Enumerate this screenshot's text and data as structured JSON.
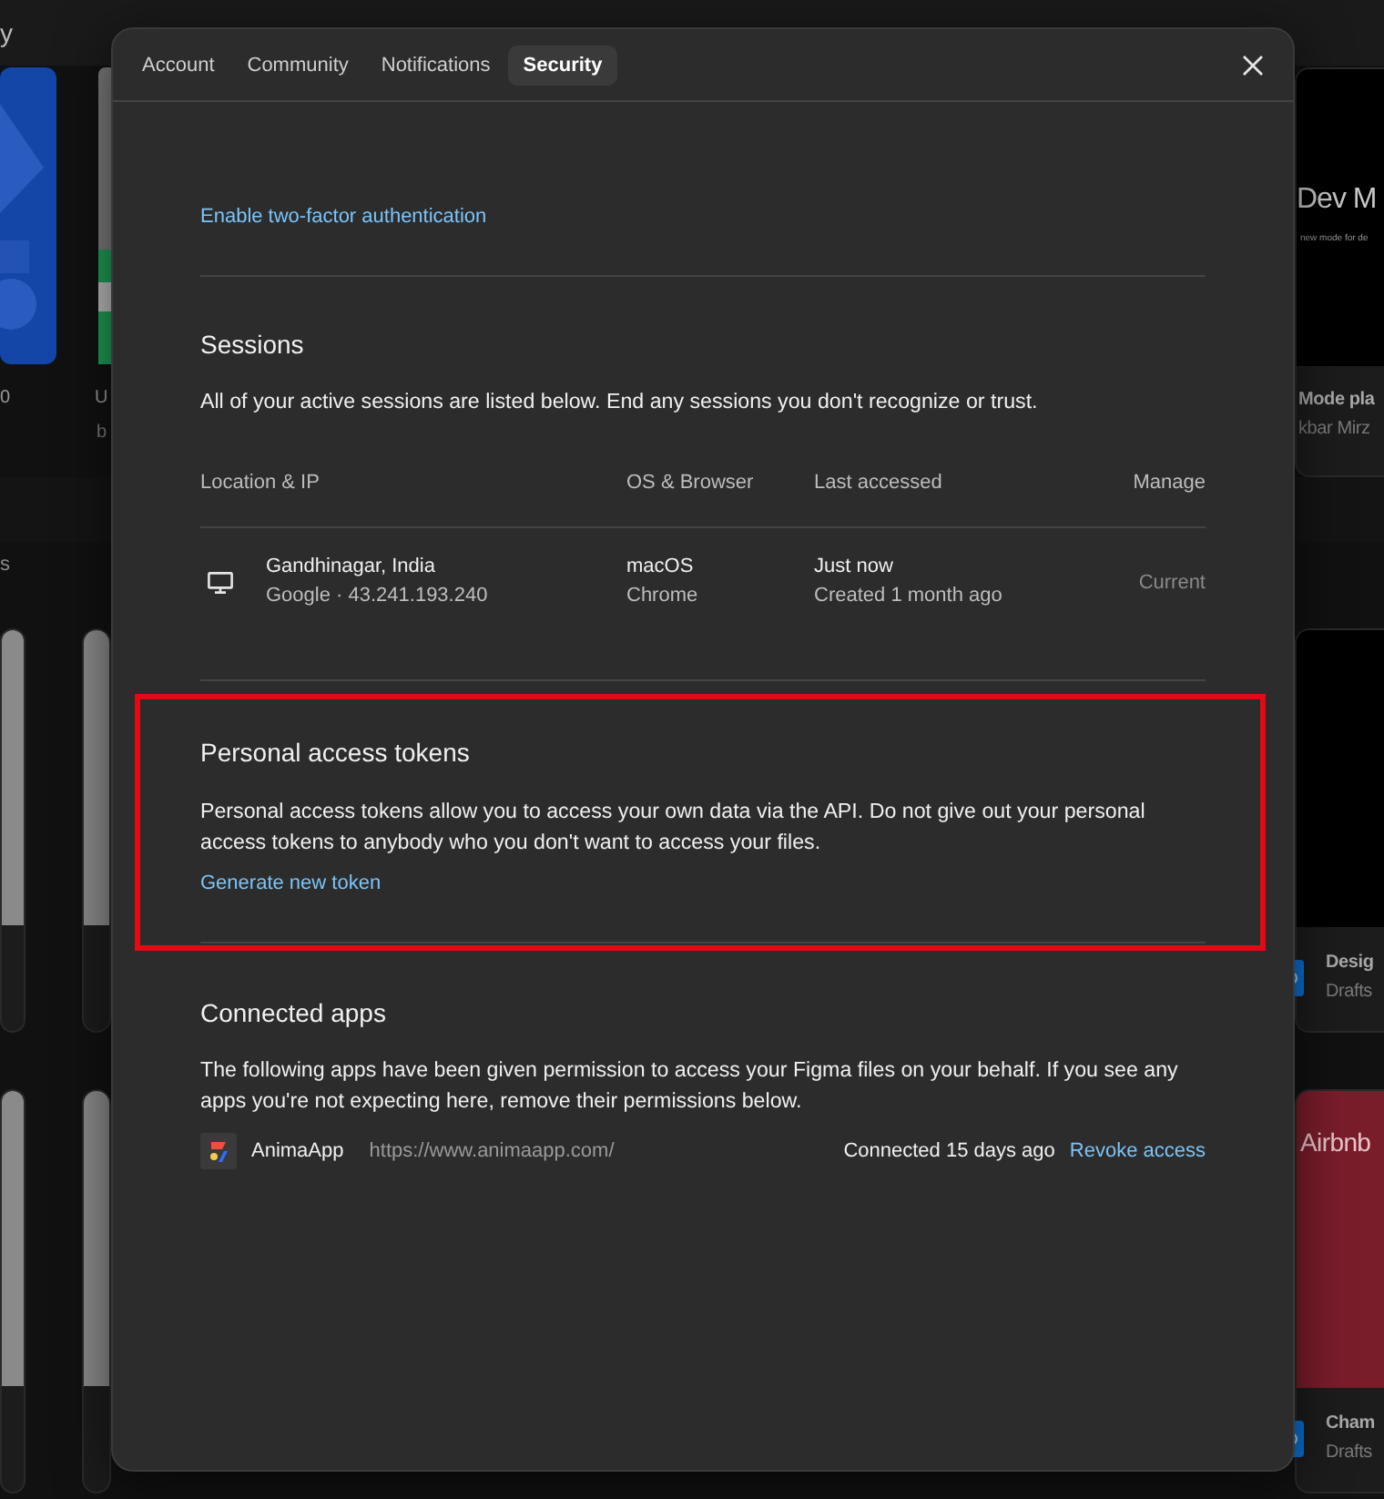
{
  "backdrop": {
    "heading_fragment": "y",
    "section_fragment": "s",
    "left_cards": [
      {
        "title": "0"
      },
      {
        "title": "U",
        "subtitle": "b"
      }
    ],
    "right_cards": [
      {
        "thumb_title": "Dev M",
        "thumb_caption": "new mode for de",
        "title": "Mode pla",
        "subtitle": "kbar Mirz"
      },
      {
        "title": "Desig",
        "subtitle": "Drafts"
      },
      {
        "thumb_title": "Airbnb",
        "title": "Cham",
        "subtitle": "Drafts"
      }
    ]
  },
  "dialog": {
    "tabs": [
      {
        "label": "Account",
        "selected": false
      },
      {
        "label": "Community",
        "selected": false
      },
      {
        "label": "Notifications",
        "selected": false
      },
      {
        "label": "Security",
        "selected": true
      }
    ],
    "two_factor_link": "Enable two-factor authentication",
    "sessions": {
      "title": "Sessions",
      "description": "All of your active sessions are listed below. End any sessions you don't recognize or trust.",
      "columns": [
        "Location & IP",
        "OS & Browser",
        "Last accessed",
        "Manage"
      ],
      "rows": [
        {
          "location": "Gandhinagar, India",
          "ip": "Google · 43.241.193.240",
          "os": "macOS",
          "browser": "Chrome",
          "last_accessed": "Just now",
          "created": "Created 1 month ago",
          "manage": "Current"
        }
      ]
    },
    "tokens": {
      "title": "Personal access tokens",
      "description": "Personal access tokens allow you to access your own data via the API. Do not give out your personal access tokens to anybody who you don't want to access your files.",
      "link": "Generate new token",
      "highlighted": true
    },
    "connected_apps": {
      "title": "Connected apps",
      "description": "The following apps have been given permission to access your Figma files on your behalf. If you see any apps you're not expecting here, remove their permissions below.",
      "apps": [
        {
          "name": "AnimaApp",
          "url": "https://www.animaapp.com/",
          "connected": "Connected 15 days ago",
          "action": "Revoke access"
        }
      ]
    }
  }
}
